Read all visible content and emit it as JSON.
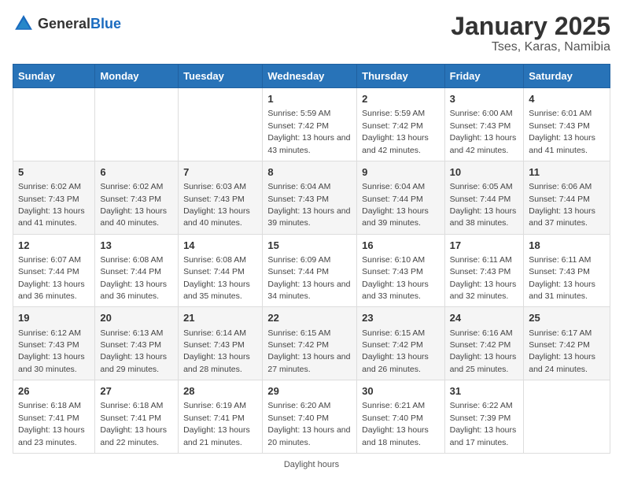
{
  "header": {
    "logo_general": "General",
    "logo_blue": "Blue",
    "title": "January 2025",
    "subtitle": "Tses, Karas, Namibia"
  },
  "days_of_week": [
    "Sunday",
    "Monday",
    "Tuesday",
    "Wednesday",
    "Thursday",
    "Friday",
    "Saturday"
  ],
  "weeks": [
    [
      null,
      null,
      null,
      {
        "day": "1",
        "sunrise": "Sunrise: 5:59 AM",
        "sunset": "Sunset: 7:42 PM",
        "daylight": "Daylight: 13 hours and 43 minutes."
      },
      {
        "day": "2",
        "sunrise": "Sunrise: 5:59 AM",
        "sunset": "Sunset: 7:42 PM",
        "daylight": "Daylight: 13 hours and 42 minutes."
      },
      {
        "day": "3",
        "sunrise": "Sunrise: 6:00 AM",
        "sunset": "Sunset: 7:43 PM",
        "daylight": "Daylight: 13 hours and 42 minutes."
      },
      {
        "day": "4",
        "sunrise": "Sunrise: 6:01 AM",
        "sunset": "Sunset: 7:43 PM",
        "daylight": "Daylight: 13 hours and 41 minutes."
      }
    ],
    [
      {
        "day": "5",
        "sunrise": "Sunrise: 6:02 AM",
        "sunset": "Sunset: 7:43 PM",
        "daylight": "Daylight: 13 hours and 41 minutes."
      },
      {
        "day": "6",
        "sunrise": "Sunrise: 6:02 AM",
        "sunset": "Sunset: 7:43 PM",
        "daylight": "Daylight: 13 hours and 40 minutes."
      },
      {
        "day": "7",
        "sunrise": "Sunrise: 6:03 AM",
        "sunset": "Sunset: 7:43 PM",
        "daylight": "Daylight: 13 hours and 40 minutes."
      },
      {
        "day": "8",
        "sunrise": "Sunrise: 6:04 AM",
        "sunset": "Sunset: 7:43 PM",
        "daylight": "Daylight: 13 hours and 39 minutes."
      },
      {
        "day": "9",
        "sunrise": "Sunrise: 6:04 AM",
        "sunset": "Sunset: 7:44 PM",
        "daylight": "Daylight: 13 hours and 39 minutes."
      },
      {
        "day": "10",
        "sunrise": "Sunrise: 6:05 AM",
        "sunset": "Sunset: 7:44 PM",
        "daylight": "Daylight: 13 hours and 38 minutes."
      },
      {
        "day": "11",
        "sunrise": "Sunrise: 6:06 AM",
        "sunset": "Sunset: 7:44 PM",
        "daylight": "Daylight: 13 hours and 37 minutes."
      }
    ],
    [
      {
        "day": "12",
        "sunrise": "Sunrise: 6:07 AM",
        "sunset": "Sunset: 7:44 PM",
        "daylight": "Daylight: 13 hours and 36 minutes."
      },
      {
        "day": "13",
        "sunrise": "Sunrise: 6:08 AM",
        "sunset": "Sunset: 7:44 PM",
        "daylight": "Daylight: 13 hours and 36 minutes."
      },
      {
        "day": "14",
        "sunrise": "Sunrise: 6:08 AM",
        "sunset": "Sunset: 7:44 PM",
        "daylight": "Daylight: 13 hours and 35 minutes."
      },
      {
        "day": "15",
        "sunrise": "Sunrise: 6:09 AM",
        "sunset": "Sunset: 7:44 PM",
        "daylight": "Daylight: 13 hours and 34 minutes."
      },
      {
        "day": "16",
        "sunrise": "Sunrise: 6:10 AM",
        "sunset": "Sunset: 7:43 PM",
        "daylight": "Daylight: 13 hours and 33 minutes."
      },
      {
        "day": "17",
        "sunrise": "Sunrise: 6:11 AM",
        "sunset": "Sunset: 7:43 PM",
        "daylight": "Daylight: 13 hours and 32 minutes."
      },
      {
        "day": "18",
        "sunrise": "Sunrise: 6:11 AM",
        "sunset": "Sunset: 7:43 PM",
        "daylight": "Daylight: 13 hours and 31 minutes."
      }
    ],
    [
      {
        "day": "19",
        "sunrise": "Sunrise: 6:12 AM",
        "sunset": "Sunset: 7:43 PM",
        "daylight": "Daylight: 13 hours and 30 minutes."
      },
      {
        "day": "20",
        "sunrise": "Sunrise: 6:13 AM",
        "sunset": "Sunset: 7:43 PM",
        "daylight": "Daylight: 13 hours and 29 minutes."
      },
      {
        "day": "21",
        "sunrise": "Sunrise: 6:14 AM",
        "sunset": "Sunset: 7:43 PM",
        "daylight": "Daylight: 13 hours and 28 minutes."
      },
      {
        "day": "22",
        "sunrise": "Sunrise: 6:15 AM",
        "sunset": "Sunset: 7:42 PM",
        "daylight": "Daylight: 13 hours and 27 minutes."
      },
      {
        "day": "23",
        "sunrise": "Sunrise: 6:15 AM",
        "sunset": "Sunset: 7:42 PM",
        "daylight": "Daylight: 13 hours and 26 minutes."
      },
      {
        "day": "24",
        "sunrise": "Sunrise: 6:16 AM",
        "sunset": "Sunset: 7:42 PM",
        "daylight": "Daylight: 13 hours and 25 minutes."
      },
      {
        "day": "25",
        "sunrise": "Sunrise: 6:17 AM",
        "sunset": "Sunset: 7:42 PM",
        "daylight": "Daylight: 13 hours and 24 minutes."
      }
    ],
    [
      {
        "day": "26",
        "sunrise": "Sunrise: 6:18 AM",
        "sunset": "Sunset: 7:41 PM",
        "daylight": "Daylight: 13 hours and 23 minutes."
      },
      {
        "day": "27",
        "sunrise": "Sunrise: 6:18 AM",
        "sunset": "Sunset: 7:41 PM",
        "daylight": "Daylight: 13 hours and 22 minutes."
      },
      {
        "day": "28",
        "sunrise": "Sunrise: 6:19 AM",
        "sunset": "Sunset: 7:41 PM",
        "daylight": "Daylight: 13 hours and 21 minutes."
      },
      {
        "day": "29",
        "sunrise": "Sunrise: 6:20 AM",
        "sunset": "Sunset: 7:40 PM",
        "daylight": "Daylight: 13 hours and 20 minutes."
      },
      {
        "day": "30",
        "sunrise": "Sunrise: 6:21 AM",
        "sunset": "Sunset: 7:40 PM",
        "daylight": "Daylight: 13 hours and 18 minutes."
      },
      {
        "day": "31",
        "sunrise": "Sunrise: 6:22 AM",
        "sunset": "Sunset: 7:39 PM",
        "daylight": "Daylight: 13 hours and 17 minutes."
      },
      null
    ]
  ],
  "footer": {
    "daylight_label": "Daylight hours"
  }
}
